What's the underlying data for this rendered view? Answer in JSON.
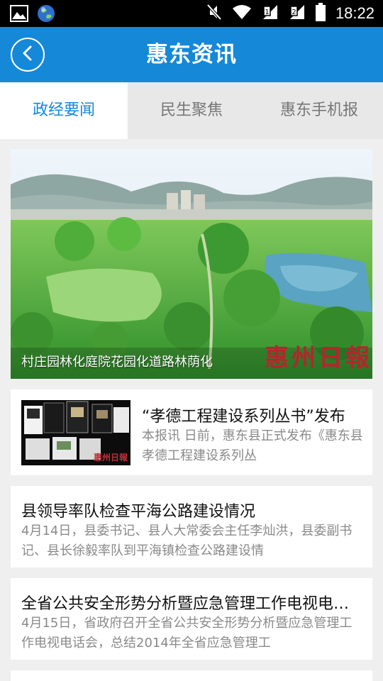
{
  "status_bar": {
    "time": "18:22",
    "icons": [
      "image-icon",
      "globe-icon",
      "mute-icon",
      "wifi-icon",
      "sim1-signal-icon",
      "sim2-signal-icon",
      "battery-icon"
    ]
  },
  "header": {
    "title": "惠东资讯",
    "back_icon": "back-arrow-icon",
    "color": "#1588d8"
  },
  "tabs": [
    {
      "label": "政经要闻",
      "active": true
    },
    {
      "label": "民生聚焦",
      "active": false
    },
    {
      "label": "惠东手机报",
      "active": false
    }
  ],
  "banner": {
    "caption": "村庄园林化庭院花园化道路林荫化",
    "watermark": "惠州日報"
  },
  "news": [
    {
      "title": "“孝德工程建设系列丛书”发布",
      "summary": "本报讯 日前，惠东县正式发布《惠东县孝德工程建设系列丛",
      "thumb_watermark": "惠州日報"
    },
    {
      "title": "县领导率队检查平海公路建设情况",
      "summary": "4月14日，县委书记、县人大常委会主任李灿洪，县委副书记、县长徐毅率队到平海镇检查公路建设情"
    },
    {
      "title": "全省公共安全形势分析暨应急管理工作电视电话会",
      "summary": "4月15日，省政府召开全省公共安全形势分析暨应急管理工作电视电话会，总结2014年全省应急管理工"
    }
  ]
}
